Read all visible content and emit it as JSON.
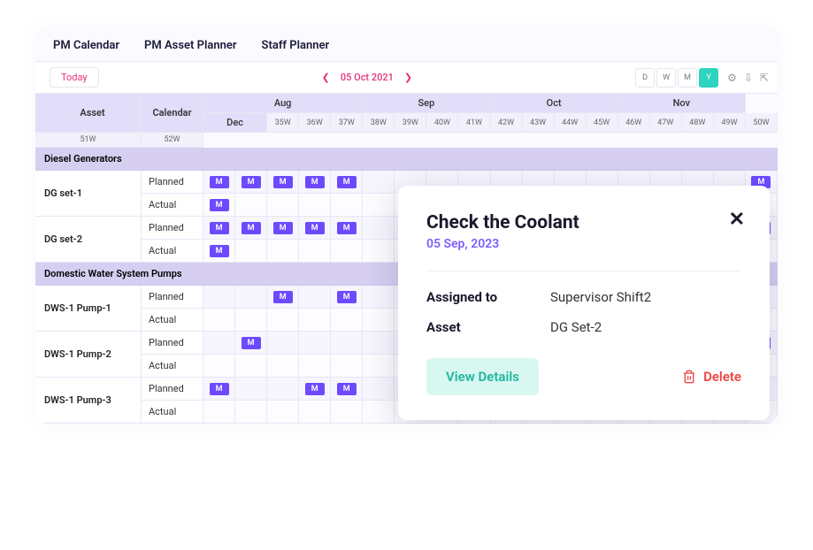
{
  "tabs": [
    "PM Calendar",
    "PM Asset Planner",
    "Staff Planner"
  ],
  "toolbar": {
    "today": "Today",
    "date": "05 Oct 2021",
    "views": [
      "D",
      "W",
      "M",
      "Y"
    ],
    "activeView": "Y"
  },
  "headers": {
    "asset": "Asset",
    "calendar": "Calendar",
    "months": [
      "Aug",
      "Sep",
      "Oct",
      "Nov",
      "Dec"
    ],
    "monthSpans": [
      5,
      4,
      4,
      4,
      2
    ],
    "weeks": [
      "35W",
      "36W",
      "37W",
      "38W",
      "39W",
      "40W",
      "41W",
      "42W",
      "43W",
      "44W",
      "45W",
      "46W",
      "47W",
      "48W",
      "49W",
      "50W",
      "51W",
      "52W"
    ]
  },
  "rowTypes": {
    "planned": "Planned",
    "actual": "Actual"
  },
  "chip": "M",
  "groups": [
    {
      "name": "Diesel Generators",
      "assets": [
        {
          "name": "DG set-1",
          "planned": [
            0,
            1,
            2,
            3,
            4,
            17
          ],
          "actual": [
            0
          ]
        },
        {
          "name": "DG set-2",
          "planned": [
            0,
            1,
            2,
            3,
            4,
            17
          ],
          "actual": [
            0
          ]
        }
      ]
    },
    {
      "name": "Domestic Water System Pumps",
      "assets": [
        {
          "name": "DWS-1 Pump-1",
          "planned": [
            2,
            4
          ],
          "actual": []
        },
        {
          "name": "DWS-1 Pump-2",
          "planned": [
            1,
            17
          ],
          "actual": []
        },
        {
          "name": "DWS-1 Pump-3",
          "planned": [
            0,
            3,
            4
          ],
          "actual": []
        }
      ]
    }
  ],
  "popup": {
    "title": "Check the Coolant",
    "date": "05 Sep, 2023",
    "assignedLabel": "Assigned to",
    "assignedValue": "Supervisor Shift2",
    "assetLabel": "Asset",
    "assetValue": "DG Set-2",
    "viewDetails": "View Details",
    "delete": "Delete"
  }
}
